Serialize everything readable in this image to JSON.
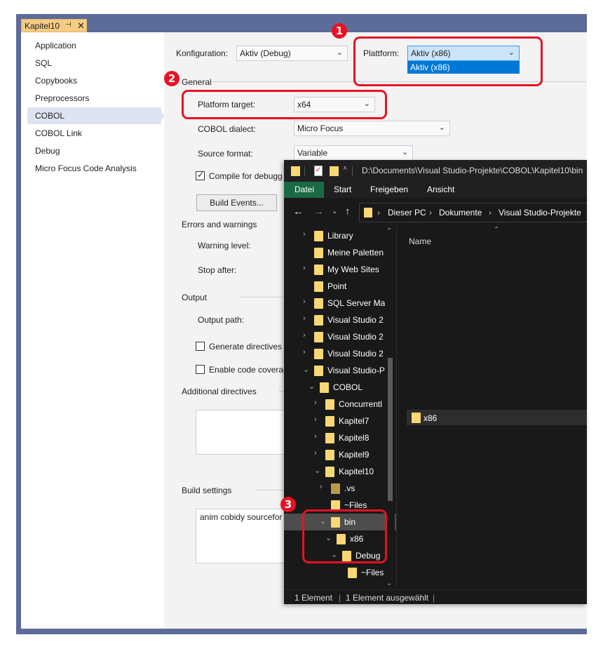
{
  "doc_tab": {
    "title": "Kapitel10",
    "pin": "⊣",
    "close": "✕"
  },
  "sidebar": {
    "items": [
      "Application",
      "SQL",
      "Copybooks",
      "Preprocessors",
      "COBOL",
      "COBOL Link",
      "Debug",
      "Micro Focus Code Analysis"
    ],
    "selected": "COBOL"
  },
  "header": {
    "config_label": "Konfiguration:",
    "config_value": "Aktiv (Debug)",
    "platform_label": "Plattform:",
    "platform_value": "Aktiv (x86)",
    "platform_option": "Aktiv (x86)"
  },
  "general": {
    "section": "General",
    "platform_target_label": "Platform target:",
    "platform_target_value": "x64",
    "dialect_label": "COBOL dialect:",
    "dialect_value": "Micro Focus",
    "source_format_label": "Source format:",
    "source_format_value": "Variable",
    "compile_debug_label": "Compile for debugg",
    "build_events_label": "Build Events..."
  },
  "errors": {
    "section": "Errors and warnings",
    "warning_level_label": "Warning level:",
    "stop_after_label": "Stop after:"
  },
  "output": {
    "section": "Output",
    "output_path_label": "Output path:",
    "gen_directives_label": "Generate directives f",
    "code_coverage_label": "Enable code coverag"
  },
  "additional": {
    "section": "Additional directives"
  },
  "build": {
    "section": "Build settings",
    "value": "anim cobidy sourcefor"
  },
  "badges": [
    "1",
    "2",
    "3"
  ],
  "explorer": {
    "path": "D:\\Documents\\Visual Studio-Projekte\\COBOL\\Kapitel10\\bin",
    "ribbon": [
      "Datei",
      "Start",
      "Freigeben",
      "Ansicht"
    ],
    "breadcrumbs": [
      "Dieser PC",
      "Dokumente",
      "Visual Studio-Projekte"
    ],
    "column_name": "Name",
    "content_items": [
      "x86"
    ],
    "tree": [
      {
        "name": "Library",
        "chev": "›",
        "indent": 0
      },
      {
        "name": "Meine Paletten",
        "chev": "",
        "indent": 0
      },
      {
        "name": "My Web Sites",
        "chev": "›",
        "indent": 0
      },
      {
        "name": "Point",
        "chev": "",
        "indent": 0
      },
      {
        "name": "SQL Server Ma",
        "chev": "›",
        "indent": 0
      },
      {
        "name": "Visual Studio 2",
        "chev": "›",
        "indent": 0
      },
      {
        "name": "Visual Studio 2",
        "chev": "›",
        "indent": 0
      },
      {
        "name": "Visual Studio 2",
        "chev": "›",
        "indent": 0
      },
      {
        "name": "Visual Studio-P",
        "chev": "⌄",
        "indent": 0
      },
      {
        "name": "COBOL",
        "chev": "⌄",
        "indent": 1
      },
      {
        "name": "Concurrentl",
        "chev": "›",
        "indent": 2
      },
      {
        "name": "Kapitel7",
        "chev": "›",
        "indent": 2
      },
      {
        "name": "Kapitel8",
        "chev": "›",
        "indent": 2
      },
      {
        "name": "Kapitel9",
        "chev": "›",
        "indent": 2
      },
      {
        "name": "Kapitel10",
        "chev": "⌄",
        "indent": 2
      },
      {
        "name": ".vs",
        "chev": "›",
        "indent": 3
      },
      {
        "name": "~Files",
        "chev": "",
        "indent": 3
      },
      {
        "name": "bin",
        "chev": "⌄",
        "indent": 3
      },
      {
        "name": "x86",
        "chev": "⌄",
        "indent": 4
      },
      {
        "name": "Debug",
        "chev": "⌄",
        "indent": 5
      },
      {
        "name": "~Files",
        "chev": "",
        "indent": 6
      }
    ],
    "status_count": "1 Element",
    "status_selected": "1 Element ausgewählt"
  }
}
